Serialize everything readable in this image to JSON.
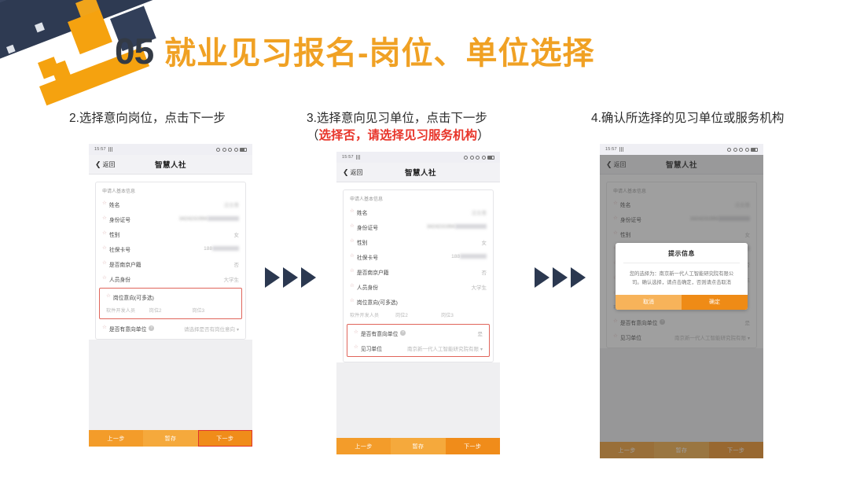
{
  "slide": {
    "number": "05",
    "title": "就业见习报名-岗位、单位选择",
    "accent_color": "#f0a124",
    "navy_color": "#2e3a52"
  },
  "captions": {
    "step2": "2.选择意向岗位，点击下一步",
    "step3_main": "3.选择意向见习单位，点击下一步",
    "step3_sub_open": "（",
    "step3_sub_red": "选择否，请选择见习服务机构",
    "step3_sub_close": "）",
    "step4": "4.确认所选择的见习单位或服务机构"
  },
  "arrows": {
    "glyph": "triangle-right",
    "count": 3,
    "color": "#2b3850"
  },
  "phone_common": {
    "status_time": "15:57",
    "back_label": "返回",
    "app_title": "智慧人社",
    "card_label": "申请人基本信息",
    "fields": [
      {
        "label": "姓名",
        "value": "汪文青",
        "blurred": true
      },
      {
        "label": "身份证号",
        "value": "3424231994",
        "blurred": true,
        "masked": true
      },
      {
        "label": "性别",
        "value": "女",
        "blurred": false
      },
      {
        "label": "社保卡号",
        "value": "188",
        "blurred": true,
        "masked": true
      },
      {
        "label": "是否南京户籍",
        "value": "否",
        "blurred": false
      },
      {
        "label": "人员身份",
        "value": "大学生",
        "blurred": false
      }
    ],
    "job_intent_label": "岗位意向(可多选)",
    "job_tags": [
      "软件开发人员",
      "岗位2",
      "岗位3"
    ],
    "has_target_unit_label": "是否有意向单位",
    "bottom_buttons": [
      "上一步",
      "暂存",
      "下一步"
    ]
  },
  "phone1": {
    "has_target_unit_value": "请选择是否有岗位意向",
    "highlight_next": true
  },
  "phone2": {
    "has_target_unit_value": "是",
    "practice_unit_label": "见习单位",
    "practice_unit_value": "南京新一代人工智能研究院有限"
  },
  "phone3": {
    "has_target_unit_value": "是",
    "practice_unit_label": "见习单位",
    "practice_unit_value": "南京新一代人工智能研究院有限",
    "dialog": {
      "title": "提示信息",
      "message": "您的选择为：南京新一代人工智能研究院有限公司。确认选择，请点击确定，否则请点击取消",
      "cancel_label": "取消",
      "confirm_label": "确定"
    }
  }
}
